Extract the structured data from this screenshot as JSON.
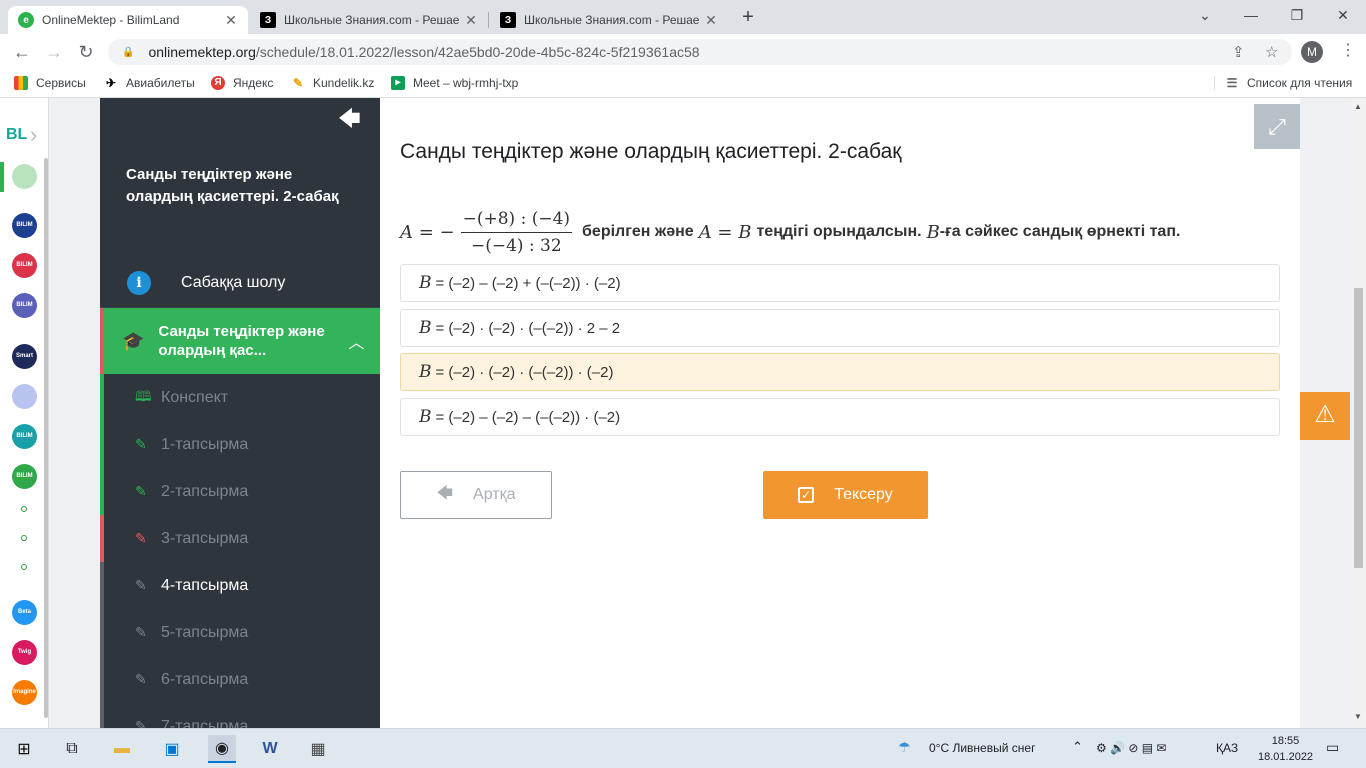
{
  "browser": {
    "tabs": [
      {
        "title": "OnlineMektep - BilimLand",
        "favicon": "bilimland-icon",
        "active": true
      },
      {
        "title": "Школьные Знания.com - Решае",
        "favicon": "znanija-icon",
        "active": false
      },
      {
        "title": "Школьные Знания.com - Решае",
        "favicon": "znanija-icon",
        "active": false
      }
    ],
    "url_host": "onlinemektep.org",
    "url_path": "/schedule/18.01.2022/lesson/42ae5bd0-20de-4b5c-824c-5f219361ac58",
    "profile_initial": "M",
    "bookmarks": [
      "Сервисы",
      "Авиабилеты",
      "Яндекс",
      "Kundelik.kz",
      "Meet – wbj-rmhj-txp"
    ],
    "reading_list": "Список для чтения"
  },
  "rail": {
    "brand": "BL",
    "items": [
      "BILIM TUTOR",
      "BILIM SHOP",
      "BILIM OLYMP",
      "Smart Nation",
      "",
      "BILIM DIVISION",
      "BILIM Land",
      "Beta",
      "Twig",
      "Imagine"
    ]
  },
  "sidebar": {
    "course_title": "Санды теңдіктер және олардың қасиеттері. 2-сабақ",
    "overview": "Сабаққа шолу",
    "section_label": "Санды теңдіктер және олардың қас...",
    "items": [
      "Конспект",
      "1-тапсырма",
      "2-тапсырма",
      "3-тапсырма",
      "4-тапсырма",
      "5-тапсырма",
      "6-тапсырма",
      "7-тапсырма"
    ]
  },
  "content": {
    "title": "Санды теңдіктер және олардың қасиеттері. 2-сабақ",
    "question": {
      "lhs": "A = −",
      "numerator": "−(+8) : (−4)",
      "denominator": "−(−4) : 32",
      "text1": "берілген және",
      "eq": "A = B",
      "text2": "теңдігі орындалсын.",
      "bvar": "B",
      "text3": "-ға сәйкес сандық өрнекті тап."
    },
    "options": [
      {
        "var": "B",
        "expr": "= (–2) – (–2) + (–(–2)) · (–2)"
      },
      {
        "var": "B",
        "expr": "= (–2) · (–2) · (–(–2)) · 2 – 2"
      },
      {
        "var": "B",
        "expr": "= (–2) · (–2) · (–(–2)) · (–2)"
      },
      {
        "var": "B",
        "expr": "= (–2) – (–2) – (–(–2)) · (–2)"
      }
    ],
    "selected_option": 2,
    "back_label": "Артқа",
    "check_label": "Тексеру"
  },
  "taskbar": {
    "weather": "0°C  Ливневый снег",
    "lang": "ҚАЗ",
    "time": "18:55",
    "date": "18.01.2022"
  },
  "colors": {
    "accent_green": "#33b35a",
    "accent_orange": "#f29630",
    "sidebar_bg": "#2e353d",
    "selected_option_bg": "#fdf3df"
  }
}
